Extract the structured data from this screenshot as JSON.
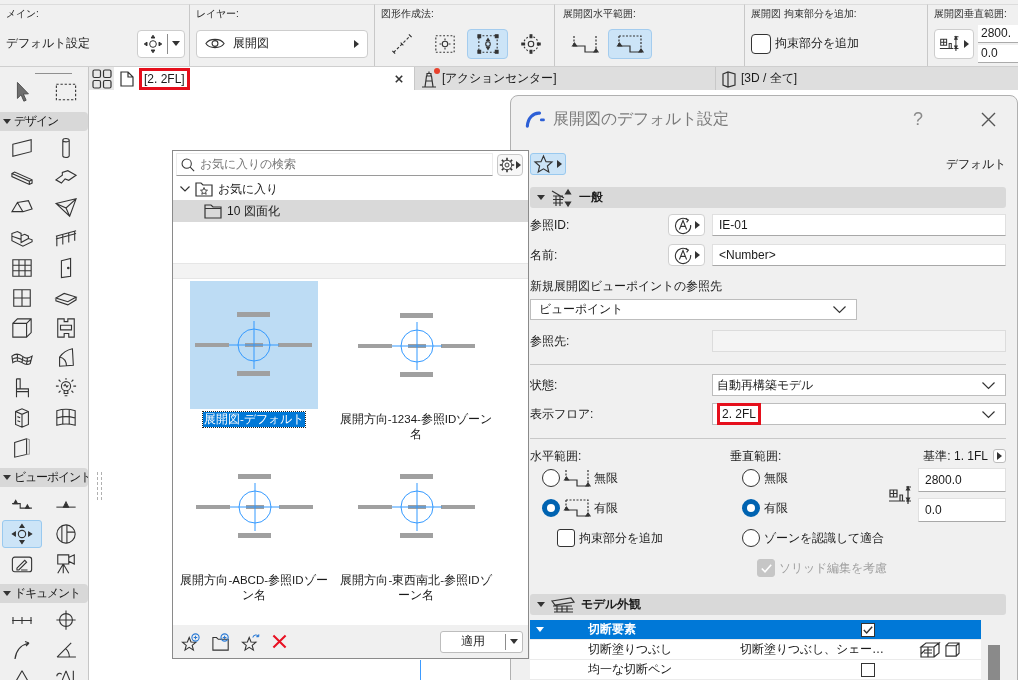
{
  "info_box": {
    "main": {
      "label": "メイン:",
      "setting": "デフォルト設定"
    },
    "layer": {
      "label": "レイヤー:",
      "value": "展開図"
    },
    "geometry_method": {
      "label": "図形作成法:",
      "options": [
        {
          "selected": false
        },
        {
          "selected": false
        },
        {
          "selected": true
        },
        {
          "selected": false
        }
      ]
    },
    "horizontal_range": {
      "label": "展開図水平範囲:",
      "options": [
        {
          "selected": false
        },
        {
          "selected": true
        }
      ]
    },
    "add_constraint": {
      "label": "展開図 拘束部分を追加:",
      "checkbox": {
        "label": "拘束部分を追加",
        "checked": false
      }
    },
    "vertical_range": {
      "label": "展開図垂直範囲:",
      "upper": "2800.",
      "lower": "0.0"
    }
  },
  "tabs": [
    {
      "kind": "plan",
      "label": "[2. 2FL]",
      "selected": true,
      "highlighted": true,
      "alert": false
    },
    {
      "kind": "center",
      "label": "[アクションセンター]",
      "selected": false,
      "highlighted": false,
      "alert": true
    },
    {
      "kind": "model",
      "label": "[3D / 全て]",
      "selected": false,
      "highlighted": false,
      "alert": false
    }
  ],
  "toolbox": {
    "tools": [
      {
        "kind": "arrow",
        "selected": false
      },
      {
        "kind": "marquee",
        "selected": false
      }
    ],
    "sections": [
      {
        "title": "デザイン",
        "expanded": true,
        "tools": [
          {
            "kind": "wall",
            "selected": false
          },
          {
            "kind": "column",
            "selected": false
          },
          {
            "kind": "beam",
            "selected": false
          },
          {
            "kind": "slab",
            "selected": false
          },
          {
            "kind": "roof",
            "selected": false
          },
          {
            "kind": "shell",
            "selected": false
          },
          {
            "kind": "stair",
            "selected": false
          },
          {
            "kind": "railing",
            "selected": false
          },
          {
            "kind": "curtainwall",
            "selected": false
          },
          {
            "kind": "door",
            "selected": false
          },
          {
            "kind": "window",
            "selected": false
          },
          {
            "kind": "skylight",
            "selected": false
          },
          {
            "kind": "opening",
            "selected": false
          },
          {
            "kind": "zone",
            "selected": false
          },
          {
            "kind": "mesh",
            "selected": false
          },
          {
            "kind": "morph",
            "selected": false
          },
          {
            "kind": "object",
            "selected": false
          },
          {
            "kind": "lamp",
            "selected": false
          },
          {
            "kind": "cabinet",
            "selected": false
          },
          {
            "kind": "curvedwall",
            "selected": false
          },
          {
            "kind": "panel",
            "selected": false
          }
        ]
      },
      {
        "title": "ビューポイント",
        "expanded": true,
        "tools": [
          {
            "kind": "section",
            "selected": false
          },
          {
            "kind": "elevation",
            "selected": false
          },
          {
            "kind": "interior",
            "selected": true
          },
          {
            "kind": "worksheet",
            "selected": false
          },
          {
            "kind": "detail",
            "selected": false
          },
          {
            "kind": "camera",
            "selected": false
          }
        ]
      },
      {
        "title": "ドキュメント",
        "expanded": true,
        "tools": [
          {
            "kind": "dimension",
            "selected": false
          },
          {
            "kind": "level",
            "selected": false
          },
          {
            "kind": "radial",
            "selected": false
          },
          {
            "kind": "angle",
            "selected": false
          },
          {
            "kind": "spot",
            "selected": false
          },
          {
            "kind": "label",
            "selected": false
          }
        ]
      }
    ]
  },
  "favorites": {
    "search": {
      "placeholder": "お気に入りの検索"
    },
    "tree": [
      {
        "label": "お気に入り",
        "expanded": true,
        "selected": false,
        "children": [
          {
            "label": "10 図面化",
            "selected": true
          }
        ]
      }
    ],
    "items": [
      {
        "label": "展開図-デフォルト",
        "selected": true
      },
      {
        "label": "展開方向-1234-参照IDゾーン名",
        "selected": false
      },
      {
        "label": "展開方向-ABCD-参照IDゾーン名",
        "selected": false
      },
      {
        "label": "展開方向-東西南北-参照IDゾーン名",
        "selected": false
      }
    ],
    "apply": "適用"
  },
  "dialog": {
    "title": "展開図のデフォルト設定",
    "help": "?",
    "preset": "デフォルト",
    "general": {
      "title": "一般",
      "expanded": true,
      "reference_id": {
        "label": "参照ID:",
        "value": "IE-01"
      },
      "name": {
        "label": "名前:",
        "value": "<Number>"
      },
      "viewpoint_reference": {
        "label": "新規展開図ビューポイントの参照先",
        "value": "ビューポイント"
      },
      "reference_target": {
        "label": "参照先:",
        "disabled": true
      },
      "status": {
        "label": "状態:",
        "value": "自動再構築モデル"
      },
      "floor": {
        "label": "表示フロア:",
        "value": "2. 2FL",
        "highlighted": true
      },
      "horizontal": {
        "label": "水平範囲:",
        "options": [
          {
            "label": "無限",
            "selected": false
          },
          {
            "label": "有限",
            "selected": true
          }
        ],
        "constraint": {
          "label": "拘束部分を追加",
          "checked": false
        }
      },
      "vertical": {
        "label": "垂直範囲:",
        "options": [
          {
            "label": "無限",
            "selected": false
          },
          {
            "label": "有限",
            "selected": true
          },
          {
            "label": "ゾーンを認識して適合",
            "selected": false
          }
        ],
        "solid_edit": {
          "label": "ソリッド編集を考慮",
          "checked": true,
          "disabled": true
        }
      },
      "base": {
        "label": "基準: 1. 1FL",
        "upper": "2800.0",
        "lower": "0.0"
      }
    },
    "model_appearance": {
      "title": "モデル外観",
      "expanded": true,
      "rows": [
        {
          "kind": "group",
          "label": "切断要素",
          "expanded": true,
          "selected": true,
          "checked": true,
          "children": [
            {
              "kind": "value",
              "label": "切断塗りつぶし",
              "value": "切断塗りつぶし、シェー…",
              "selected": false
            },
            {
              "kind": "check",
              "label": "均一な切断ペン",
              "checked": false,
              "selected": false
            }
          ]
        }
      ]
    }
  }
}
